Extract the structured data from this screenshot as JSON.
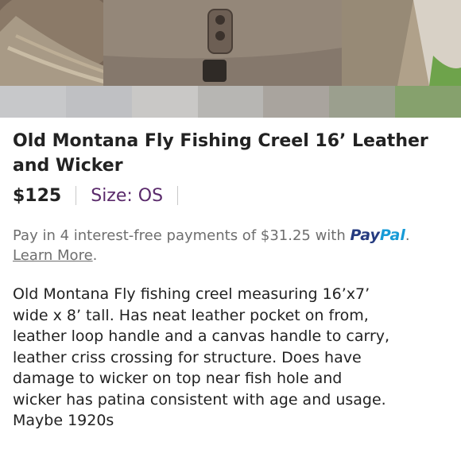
{
  "listing": {
    "title": "Old Montana Fly Fishing Creel 16’ Leather and Wicker",
    "price": "$125",
    "size": "Size: OS"
  },
  "payment": {
    "text": "Pay in 4 interest-free payments of $31.25 with",
    "brand_part1": "Pay",
    "brand_part2": "Pal",
    "learn_more": "Learn More",
    "period": "."
  },
  "description": "Old Montana Fly fishing creel measuring 16’x7’\nwide x 8’ tall. Has neat leather pocket on from,\nleather loop handle and a canvas handle to carry,\nleather criss crossing for structure.  Does have\ndamage to wicker on top near fish hole and\nwicker has patina consistent with age and usage.\nMaybe 1920s",
  "colors": {
    "size_color": "#5a2a6b",
    "paypal_dark": "#253b80",
    "paypal_light": "#179bd7"
  }
}
